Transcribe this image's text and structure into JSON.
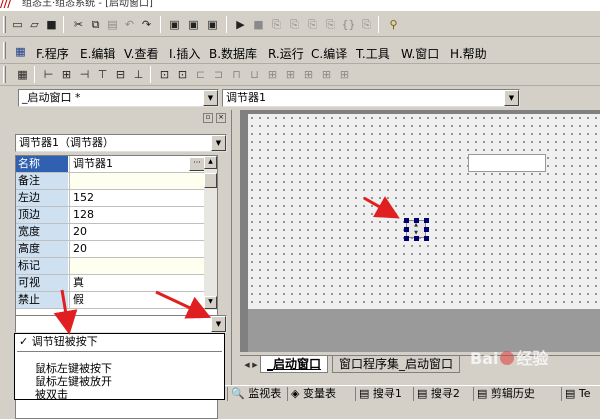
{
  "window": {
    "title": "组态王·组态系统 - [启动窗口]",
    "app_logo": "///"
  },
  "toolbar1": {
    "icons": [
      "new-icon",
      "open-icon",
      "save-icon",
      "cut-icon",
      "copy-icon",
      "paste-icon",
      "undo-icon",
      "redo-icon",
      "window-icon",
      "window2-icon",
      "window3-icon",
      "run-icon",
      "stop-icon",
      "debug-icon",
      "step-icon",
      "step2-icon",
      "step3-icon",
      "braces-icon",
      "step4-icon",
      "binoculars-icon"
    ]
  },
  "menubar": {
    "items": [
      {
        "key": "F",
        "label": "F.程序"
      },
      {
        "key": "E",
        "label": "E.编辑"
      },
      {
        "key": "V",
        "label": "V.查看"
      },
      {
        "key": "I",
        "label": "I.插入"
      },
      {
        "key": "B",
        "label": "B.数据库"
      },
      {
        "key": "R",
        "label": "R.运行"
      },
      {
        "key": "C",
        "label": "C.编译"
      },
      {
        "key": "T",
        "label": "T.工具"
      },
      {
        "key": "W",
        "label": "W.窗口"
      },
      {
        "key": "H",
        "label": "H.帮助"
      }
    ]
  },
  "selectors": {
    "window_combo": "_启动窗口 *",
    "object_combo": "调节器1"
  },
  "properties": {
    "object_combo": "调节器1（调节器）",
    "rows": [
      {
        "key": "名称",
        "value": "调节器1"
      },
      {
        "key": "备注",
        "value": ""
      },
      {
        "key": "左边",
        "value": "152"
      },
      {
        "key": "顶边",
        "value": "128"
      },
      {
        "key": "宽度",
        "value": "20"
      },
      {
        "key": "高度",
        "value": "20"
      },
      {
        "key": "标记",
        "value": ""
      },
      {
        "key": "可视",
        "value": "真"
      },
      {
        "key": "禁止",
        "value": "假"
      }
    ],
    "event_combo": ""
  },
  "event_dropdown": {
    "checked_item": "调节钮被按下",
    "checkmark": "✓",
    "items": [
      "鼠标左键被按下",
      "鼠标左键被放开",
      "被双击"
    ]
  },
  "doc_tabs": {
    "tabs": [
      "_启动窗口",
      "窗口程序集_启动窗口"
    ],
    "active": 0
  },
  "status_tabs": [
    "监视表",
    "变量表",
    "搜寻1",
    "搜寻2",
    "剪辑历史",
    "Te"
  ],
  "watermark": {
    "text_left": "Bai",
    "text_right": "经验"
  },
  "colors": {
    "selection": "#3060b0",
    "annotation_arrow": "#e02020"
  }
}
